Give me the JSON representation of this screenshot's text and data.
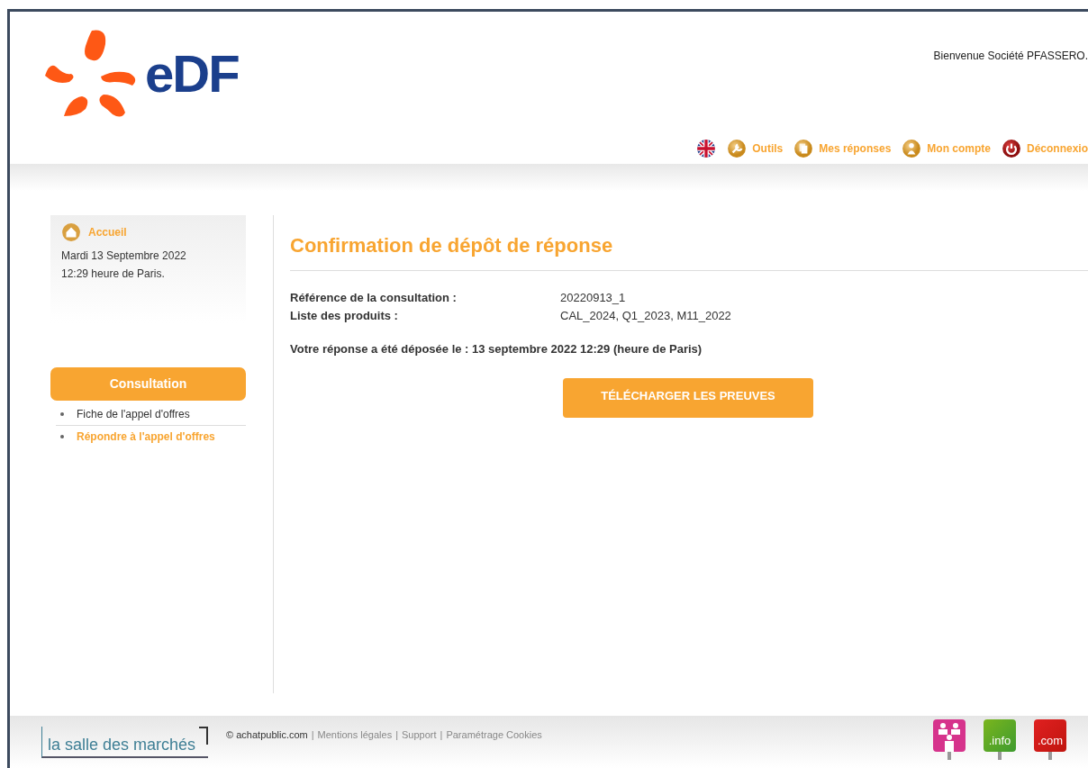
{
  "header": {
    "logo": "eDF",
    "welcome": "Bienvenue Société PFASSERO.",
    "nav": [
      {
        "label": "Outils"
      },
      {
        "label": "Mes réponses"
      },
      {
        "label": "Mon compte"
      },
      {
        "label": "Déconnexio"
      }
    ]
  },
  "sidebar": {
    "home": "Accueil",
    "date": "Mardi 13 Septembre 2022",
    "time": "12:29 heure de Paris.",
    "section": "Consultation",
    "items": [
      {
        "label": "Fiche de l'appel d'offres",
        "selected": false
      },
      {
        "label": "Répondre à l'appel d'offres",
        "selected": true
      }
    ]
  },
  "main": {
    "title": "Confirmation de dépôt de réponse",
    "fields": [
      {
        "label": "Référence de la consultation :",
        "value": "20220913_1"
      },
      {
        "label": "Liste des produits :",
        "value": "CAL_2024, Q1_2023, M11_2022"
      }
    ],
    "message": "Votre réponse a été déposée le : 13 septembre 2022 12:29 (heure de Paris)",
    "button": "TÉLÉCHARGER LES PREUVES"
  },
  "footer": {
    "brand": "la salle des marchés",
    "separator": "|",
    "links": [
      {
        "label": "© achatpublic.com"
      },
      {
        "label": "Mentions légales"
      },
      {
        "label": "Support"
      },
      {
        "label": "Paramétrage Cookies"
      }
    ],
    "badges": [
      ".info",
      ".com"
    ]
  }
}
